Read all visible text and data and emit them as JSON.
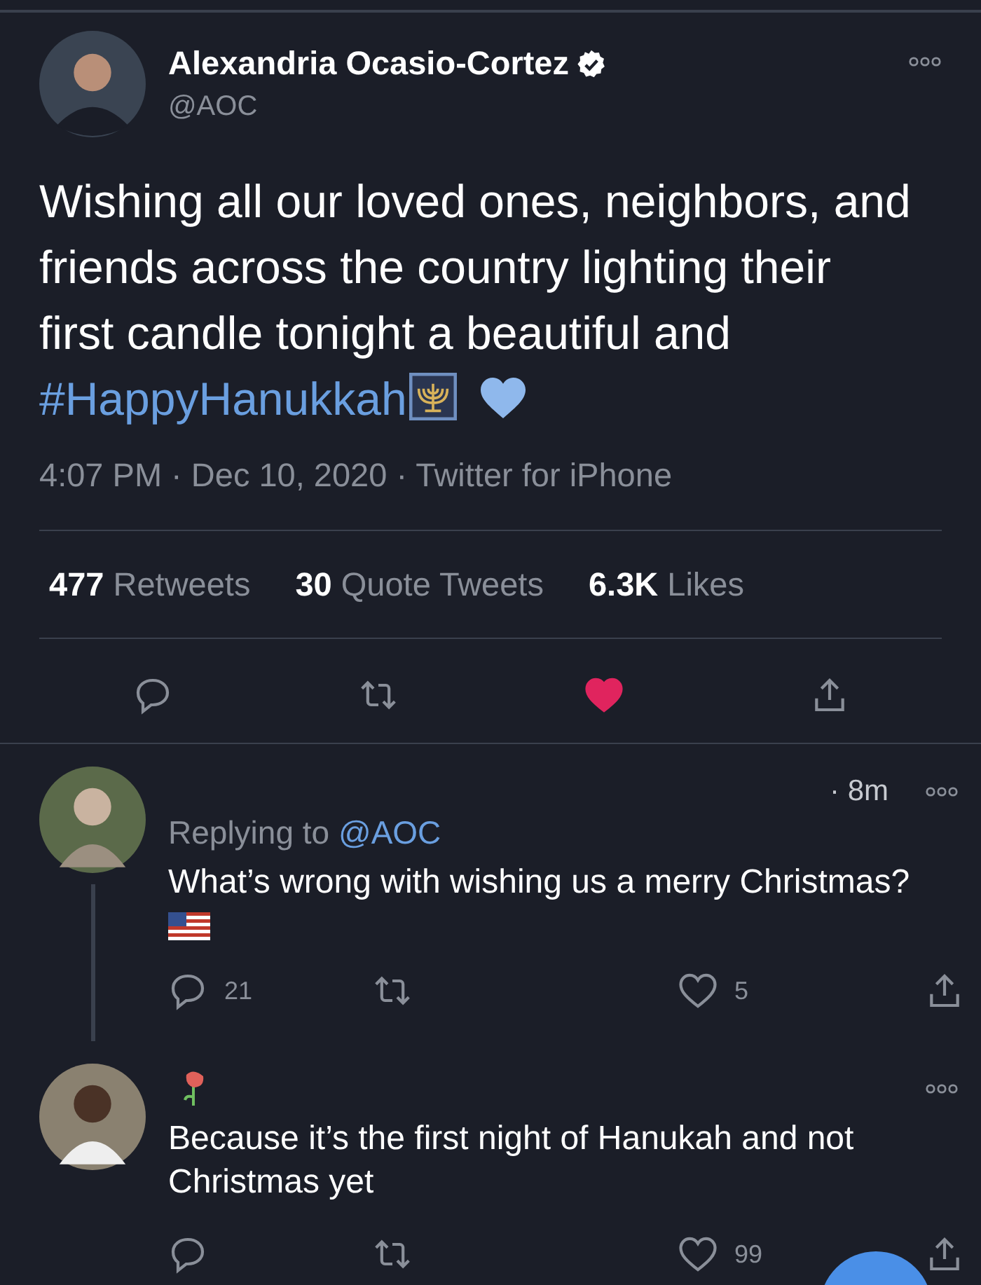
{
  "tweet": {
    "name": "Alexandria Ocasio-Cortez",
    "verified": true,
    "handle": "@AOC",
    "text_lines": [
      "Wishing all our loved ones, neighbors, and",
      "friends across the country lighting their",
      "first candle tonight a beautiful and"
    ],
    "hashtag": "#HappyHanukkah",
    "meta": "4:07 PM · Dec 10, 2020 · Twitter for iPhone",
    "stats": [
      {
        "count": "477",
        "label": "Retweets"
      },
      {
        "count": "30",
        "label": "Quote Tweets"
      },
      {
        "count": "6.3K",
        "label": "Likes"
      }
    ],
    "actions": [
      {
        "kind": "reply"
      },
      {
        "kind": "retweet"
      },
      {
        "kind": "like",
        "liked": true
      },
      {
        "kind": "share"
      }
    ]
  },
  "replies": [
    {
      "time": "· 8m",
      "replying_to": "Replying to",
      "mention": "@AOC",
      "text": "What’s wrong with wishing us a merry Christmas?",
      "flag": true,
      "thread_line": true,
      "actions": [
        {
          "kind": "reply",
          "count": "21"
        },
        {
          "kind": "retweet"
        },
        {
          "kind": "like",
          "liked": false,
          "count": "5"
        },
        {
          "kind": "share"
        }
      ]
    },
    {
      "rose": true,
      "text": "Because it’s the first night of Hanukah and not Christmas yet",
      "actions": [
        {
          "kind": "reply"
        },
        {
          "kind": "retweet"
        },
        {
          "kind": "like",
          "liked": false,
          "count": "99"
        },
        {
          "kind": "share"
        }
      ]
    }
  ]
}
